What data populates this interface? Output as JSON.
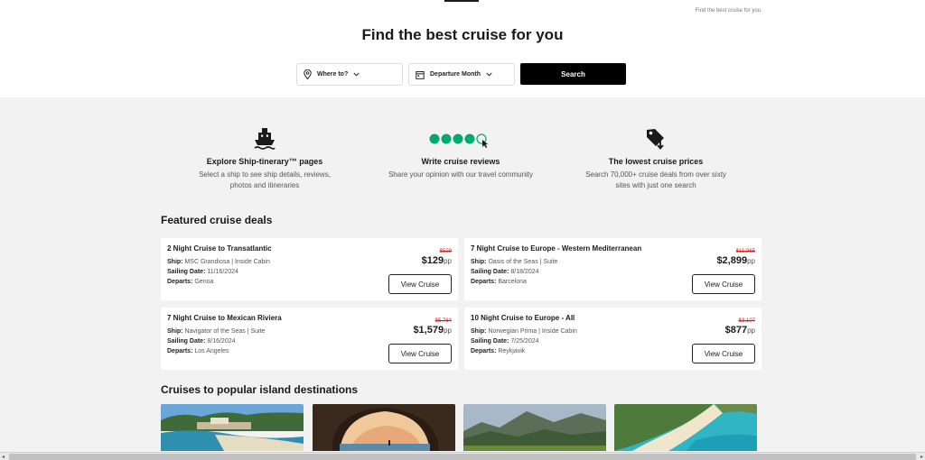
{
  "header": {
    "breadcrumb": "Find the best cruise for you",
    "title": "Find the best cruise for you"
  },
  "search": {
    "where_label": "Where to?",
    "month_label": "Departure Month",
    "button_label": "Search"
  },
  "features": [
    {
      "icon": "ship-icon",
      "title": "Explore Ship-tinerary™ pages",
      "desc1": "Select a ship to see ship details, reviews,",
      "desc2": "photos and itineraries"
    },
    {
      "icon": "rating-bubbles-icon",
      "title": "Write cruise reviews",
      "desc1": "Share your opinion with our travel community",
      "desc2": ""
    },
    {
      "icon": "price-tag-icon",
      "title": "The lowest cruise prices",
      "desc1": "Search 70,000+ cruise deals from over sixty",
      "desc2": "sites with just one search"
    }
  ],
  "featured": {
    "title": "Featured cruise deals",
    "labels": {
      "ship": "Ship:",
      "sailing": "Sailing Date:",
      "departs": "Departs:"
    },
    "pp": "pp",
    "button_label": "View Cruise",
    "deals": [
      {
        "name": "2 Night Cruise to Transatlantic",
        "ship": "MSC Grandiosa | Inside Cabin",
        "date": "11/16/2024",
        "departs": "Genoa",
        "old_price": "$529",
        "price": "$129"
      },
      {
        "name": "7 Night Cruise to Europe - Western Mediterranean",
        "ship": "Oasis of the Seas | Suite",
        "date": "8/18/2024",
        "departs": "Barcelona",
        "old_price": "$11,365",
        "price": "$2,899"
      },
      {
        "name": "7 Night Cruise to Mexican Riviera",
        "ship": "Navigator of the Seas | Suite",
        "date": "8/16/2024",
        "departs": "Los Angeles",
        "old_price": "$5,764",
        "price": "$1,579"
      },
      {
        "name": "10 Night Cruise to Europe - All",
        "ship": "Norwegian Prima | Inside Cabin",
        "date": "7/25/2024",
        "departs": "Reykjavik",
        "old_price": "$3,107",
        "price": "$877"
      }
    ]
  },
  "islands": {
    "title": "Cruises to popular island destinations"
  },
  "colors": {
    "accent_green": "#00aa6c",
    "sale_red": "#d91e18",
    "button_black": "#000000"
  }
}
